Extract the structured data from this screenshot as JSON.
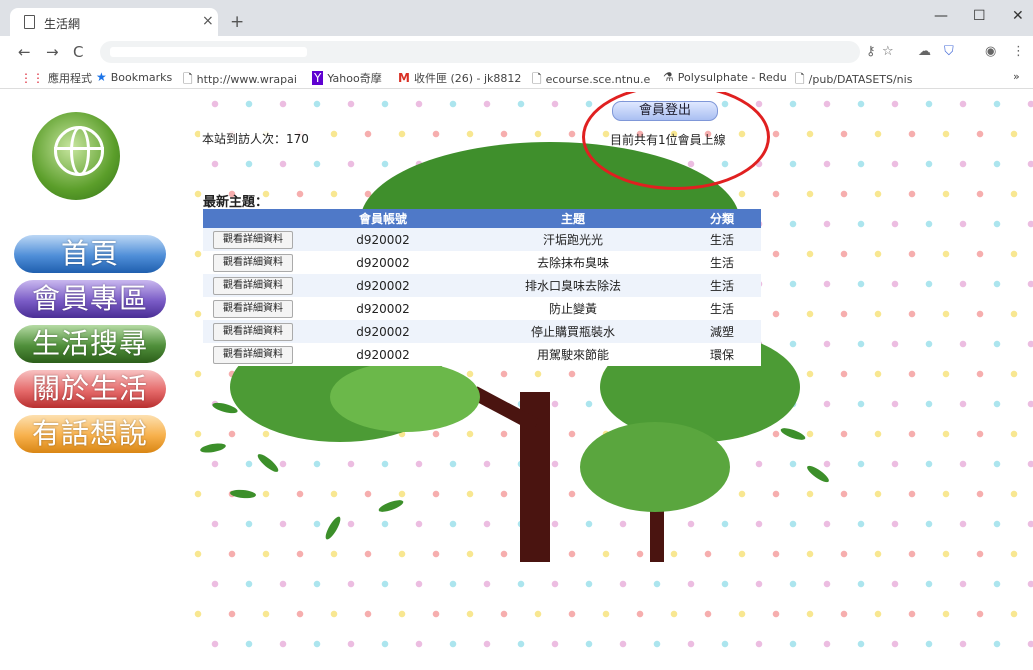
{
  "browser": {
    "tab_title": "生活網",
    "tab_close": "×",
    "new_tab": "+",
    "window_controls": [
      "—",
      "☐",
      "✕"
    ],
    "nav": {
      "back": "←",
      "forward": "→",
      "reload": "C"
    },
    "bookmarks": [
      {
        "icon": "apps-icon",
        "glyph": "⋮⋮",
        "label": "應用程式"
      },
      {
        "icon": "star-icon",
        "glyph": "★",
        "label": "Bookmarks"
      },
      {
        "icon": "page-icon",
        "glyph": "🗋",
        "label": "http://www.wrapai"
      },
      {
        "icon": "yahoo-icon",
        "glyph": "Y",
        "label": "Yahoo奇摩"
      },
      {
        "icon": "gmail-icon",
        "glyph": "M",
        "label": "收件匣 (26) - jk8812"
      },
      {
        "icon": "page-icon",
        "glyph": "🗋",
        "label": "ecourse.sce.ntnu.e"
      },
      {
        "icon": "flask-icon",
        "glyph": "⚗",
        "label": "Polysulphate - Redu"
      },
      {
        "icon": "page-icon",
        "glyph": "🗋",
        "label": "/pub/DATASETS/nis"
      }
    ],
    "bookmarks_more": "»"
  },
  "site": {
    "menu": [
      {
        "label": "首頁",
        "color": "#4f8ed8",
        "dark": "#1f5fae"
      },
      {
        "label": "會員專區",
        "color": "#7a5cc6",
        "dark": "#4a2e95"
      },
      {
        "label": "生活搜尋",
        "color": "#4f8f3a",
        "dark": "#2c5e1a"
      },
      {
        "label": "關於生活",
        "color": "#e56a6a",
        "dark": "#b82f2f"
      },
      {
        "label": "有話想說",
        "color": "#f7b04b",
        "dark": "#d98614"
      }
    ],
    "visitor_text": "本站到訪人次：170",
    "login_button": "會員登出",
    "online_text": "目前共有1位會員上線",
    "latest_title": "最新主題：",
    "table": {
      "headers": [
        "",
        "會員帳號",
        "主題",
        "分類"
      ],
      "detail_label": "觀看詳細資料",
      "rows": [
        {
          "account": "d920002",
          "topic": "汗垢跑光光",
          "category": "生活"
        },
        {
          "account": "d920002",
          "topic": "去除抹布臭味",
          "category": "生活"
        },
        {
          "account": "d920002",
          "topic": "排水口臭味去除法",
          "category": "生活"
        },
        {
          "account": "d920002",
          "topic": "防止變黃",
          "category": "生活"
        },
        {
          "account": "d920002",
          "topic": "停止購買瓶裝水",
          "category": "減塑"
        },
        {
          "account": "d920002",
          "topic": "用駕駛來節能",
          "category": "環保"
        }
      ]
    }
  }
}
